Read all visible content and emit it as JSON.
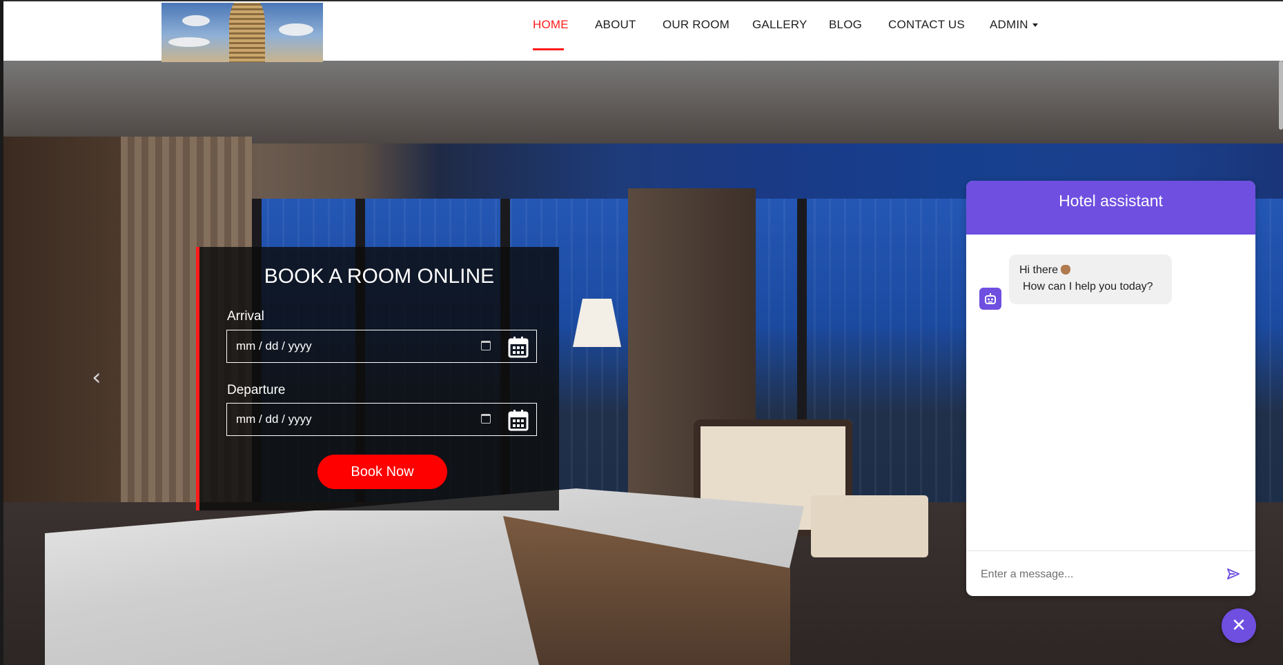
{
  "nav": {
    "items": [
      {
        "label": "HOME",
        "active": true
      },
      {
        "label": "ABOUT"
      },
      {
        "label": "OUR ROOM"
      },
      {
        "label": "GALLERY"
      },
      {
        "label": "BLOG"
      },
      {
        "label": "CONTACT US"
      },
      {
        "label": "ADMIN"
      }
    ],
    "active_color": "#ff1a1a"
  },
  "booking": {
    "title": "BOOK A ROOM ONLINE",
    "arrival_label": "Arrival",
    "arrival_value": "mm / dd / yyyy",
    "departure_label": "Departure",
    "departure_value": "mm / dd / yyyy",
    "button_label": "Book Now",
    "accent_color": "#ff0000"
  },
  "chat": {
    "title": "Hotel assistant",
    "greeting_line1": "Hi there",
    "greeting_line2": "How can I help you today?",
    "input_placeholder": "Enter a message...",
    "close_glyph": "✕",
    "brand_color": "#6e4fe0"
  },
  "slider": {
    "prev_glyph": "‹"
  }
}
